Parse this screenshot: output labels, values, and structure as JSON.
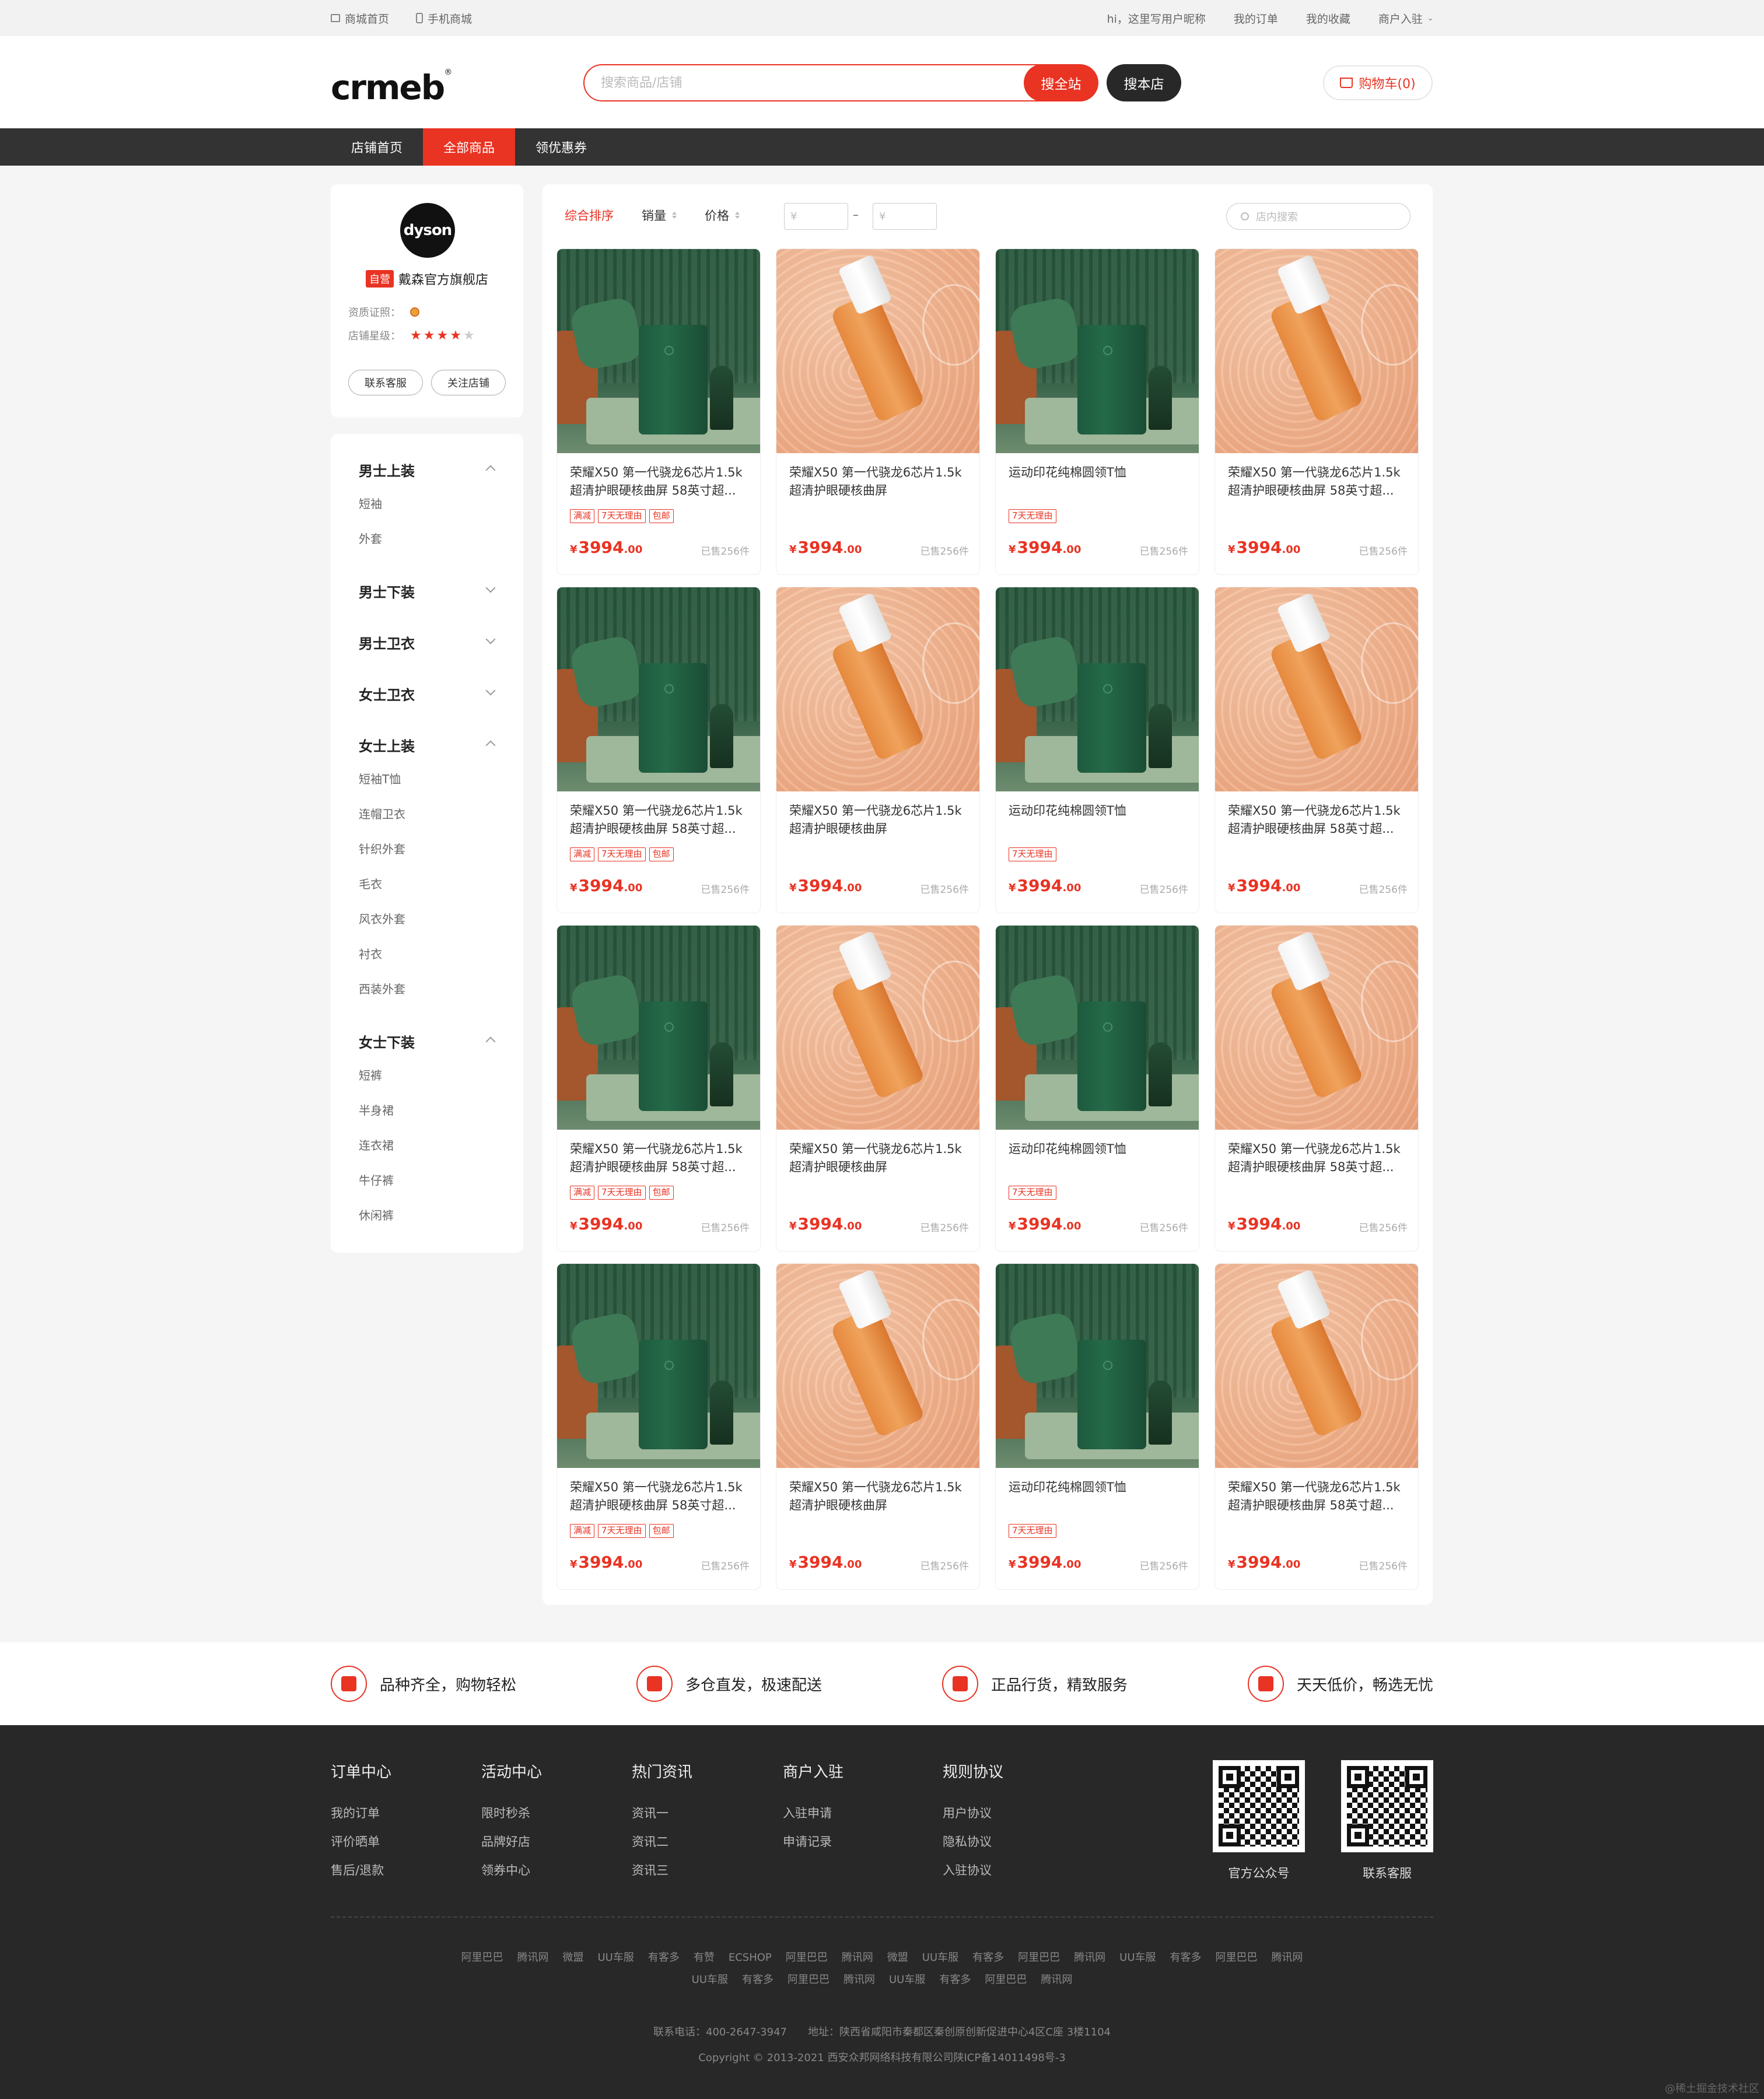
{
  "topbar": {
    "home": "商城首页",
    "mobile": "手机商城",
    "greeting": "hi，这里写用户昵称",
    "orders": "我的订单",
    "favorites": "我的收藏",
    "merchant": "商户入驻"
  },
  "header": {
    "logo": "crmeb",
    "search_placeholder": "搜索商品/店铺",
    "search_site": "搜全站",
    "search_store": "搜本店",
    "cart": "购物车(0)"
  },
  "nav": {
    "tabs": [
      "店铺首页",
      "全部商品",
      "领优惠券"
    ],
    "active": 1
  },
  "shop": {
    "logo_text": "dyson",
    "self_tag": "自营",
    "name": "戴森官方旗舰店",
    "license_label": "资质证照：",
    "rating_label": "店铺星级：",
    "rating": 4,
    "rating_max": 5,
    "contact_button": "联系客服",
    "follow_button": "关注店铺"
  },
  "categories": [
    {
      "name": "男士上装",
      "open": true,
      "subs": [
        "短袖",
        "外套"
      ]
    },
    {
      "name": "男士下装",
      "open": false,
      "subs": []
    },
    {
      "name": "男士卫衣",
      "open": false,
      "subs": []
    },
    {
      "name": "女士卫衣",
      "open": false,
      "subs": []
    },
    {
      "name": "女士上装",
      "open": true,
      "subs": [
        "短袖T恤",
        "连帽卫衣",
        "针织外套",
        "毛衣",
        "风衣外套",
        "衬衣",
        "西装外套"
      ]
    },
    {
      "name": "女士下装",
      "open": true,
      "subs": [
        "短裤",
        "半身裙",
        "连衣裙",
        "牛仔裤",
        "休闲裤"
      ]
    }
  ],
  "sortbar": {
    "default": "综合排序",
    "sales": "销量",
    "price": "价格",
    "min_placeholder": "¥",
    "max_placeholder": "¥",
    "dash": "–",
    "inshop_search": "店内搜索"
  },
  "product_templates": {
    "a": {
      "name": "荣耀X50 第一代骁龙6芯片1.5k超清护眼硬核曲屏 58英寸超...",
      "tags": [
        "满减",
        "7天无理由",
        "包邮"
      ],
      "image": "dehumidifier"
    },
    "b": {
      "name": "荣耀X50 第一代骁龙6芯片1.5k超清护眼硬核曲屏",
      "tags": [],
      "image": "serum"
    },
    "c": {
      "name": "运动印花纯棉圆领T恤",
      "tags": [
        "7天无理由"
      ],
      "image": "dehumidifier"
    },
    "d": {
      "name": "荣耀X50 第一代骁龙6芯片1.5k超清护眼硬核曲屏 58英寸超...",
      "tags": [],
      "image": "serum"
    }
  },
  "products": [
    {
      "name": "荣耀X50 第一代骁龙6芯片1.5k超清护眼硬核曲屏 58英寸超...",
      "tags": [
        "满减",
        "7天无理由",
        "包邮"
      ],
      "image": "dehumidifier",
      "currency": "¥",
      "price_int": "3994",
      "price_dec": ".00",
      "sold": "已售256件"
    },
    {
      "name": "荣耀X50 第一代骁龙6芯片1.5k超清护眼硬核曲屏",
      "tags": [],
      "image": "serum",
      "currency": "¥",
      "price_int": "3994",
      "price_dec": ".00",
      "sold": "已售256件"
    },
    {
      "name": "运动印花纯棉圆领T恤",
      "tags": [
        "7天无理由"
      ],
      "image": "dehumidifier",
      "currency": "¥",
      "price_int": "3994",
      "price_dec": ".00",
      "sold": "已售256件"
    },
    {
      "name": "荣耀X50 第一代骁龙6芯片1.5k超清护眼硬核曲屏 58英寸超...",
      "tags": [],
      "image": "serum",
      "currency": "¥",
      "price_int": "3994",
      "price_dec": ".00",
      "sold": "已售256件"
    },
    {
      "name": "荣耀X50 第一代骁龙6芯片1.5k超清护眼硬核曲屏 58英寸超...",
      "tags": [
        "满减",
        "7天无理由",
        "包邮"
      ],
      "image": "dehumidifier",
      "currency": "¥",
      "price_int": "3994",
      "price_dec": ".00",
      "sold": "已售256件"
    },
    {
      "name": "荣耀X50 第一代骁龙6芯片1.5k超清护眼硬核曲屏",
      "tags": [],
      "image": "serum",
      "currency": "¥",
      "price_int": "3994",
      "price_dec": ".00",
      "sold": "已售256件"
    },
    {
      "name": "运动印花纯棉圆领T恤",
      "tags": [
        "7天无理由"
      ],
      "image": "dehumidifier",
      "currency": "¥",
      "price_int": "3994",
      "price_dec": ".00",
      "sold": "已售256件"
    },
    {
      "name": "荣耀X50 第一代骁龙6芯片1.5k超清护眼硬核曲屏 58英寸超...",
      "tags": [],
      "image": "serum",
      "currency": "¥",
      "price_int": "3994",
      "price_dec": ".00",
      "sold": "已售256件"
    },
    {
      "name": "荣耀X50 第一代骁龙6芯片1.5k超清护眼硬核曲屏 58英寸超...",
      "tags": [
        "满减",
        "7天无理由",
        "包邮"
      ],
      "image": "dehumidifier",
      "currency": "¥",
      "price_int": "3994",
      "price_dec": ".00",
      "sold": "已售256件"
    },
    {
      "name": "荣耀X50 第一代骁龙6芯片1.5k超清护眼硬核曲屏",
      "tags": [],
      "image": "serum",
      "currency": "¥",
      "price_int": "3994",
      "price_dec": ".00",
      "sold": "已售256件"
    },
    {
      "name": "运动印花纯棉圆领T恤",
      "tags": [
        "7天无理由"
      ],
      "image": "dehumidifier",
      "currency": "¥",
      "price_int": "3994",
      "price_dec": ".00",
      "sold": "已售256件"
    },
    {
      "name": "荣耀X50 第一代骁龙6芯片1.5k超清护眼硬核曲屏 58英寸超...",
      "tags": [],
      "image": "serum",
      "currency": "¥",
      "price_int": "3994",
      "price_dec": ".00",
      "sold": "已售256件"
    },
    {
      "name": "荣耀X50 第一代骁龙6芯片1.5k超清护眼硬核曲屏 58英寸超...",
      "tags": [
        "满减",
        "7天无理由",
        "包邮"
      ],
      "image": "dehumidifier",
      "currency": "¥",
      "price_int": "3994",
      "price_dec": ".00",
      "sold": "已售256件"
    },
    {
      "name": "荣耀X50 第一代骁龙6芯片1.5k超清护眼硬核曲屏",
      "tags": [],
      "image": "serum",
      "currency": "¥",
      "price_int": "3994",
      "price_dec": ".00",
      "sold": "已售256件"
    },
    {
      "name": "运动印花纯棉圆领T恤",
      "tags": [
        "7天无理由"
      ],
      "image": "dehumidifier",
      "currency": "¥",
      "price_int": "3994",
      "price_dec": ".00",
      "sold": "已售256件"
    },
    {
      "name": "荣耀X50 第一代骁龙6芯片1.5k超清护眼硬核曲屏 58英寸超...",
      "tags": [],
      "image": "serum",
      "currency": "¥",
      "price_int": "3994",
      "price_dec": ".00",
      "sold": "已售256件"
    }
  ],
  "features": [
    {
      "icon": "bag-icon",
      "text": "品种齐全，购物轻松"
    },
    {
      "icon": "truck-icon",
      "text": "多仓直发，极速配送"
    },
    {
      "icon": "shield-icon",
      "text": "正品行货，精致服务"
    },
    {
      "icon": "coupon-icon",
      "text": "天天低价，畅选无忧"
    }
  ],
  "footer": {
    "columns": [
      {
        "title": "订单中心",
        "links": [
          "我的订单",
          "评价晒单",
          "售后/退款"
        ]
      },
      {
        "title": "活动中心",
        "links": [
          "限时秒杀",
          "品牌好店",
          "领券中心"
        ]
      },
      {
        "title": "热门资讯",
        "links": [
          "资讯一",
          "资讯二",
          "资讯三"
        ]
      },
      {
        "title": "商户入驻",
        "links": [
          "入驻申请",
          "申请记录"
        ]
      },
      {
        "title": "规则协议",
        "links": [
          "用户协议",
          "隐私协议",
          "入驻协议"
        ]
      }
    ],
    "qr": [
      {
        "caption": "官方公众号"
      },
      {
        "caption": "联系客服"
      }
    ],
    "links_row1": [
      "阿里巴巴",
      "腾讯网",
      "微盟",
      "UU车服",
      "有客多",
      "有赞",
      "ECSHOP",
      "阿里巴巴",
      "腾讯网",
      "微盟",
      "UU车服",
      "有客多",
      "阿里巴巴",
      "腾讯网",
      "UU车服",
      "有客多",
      "阿里巴巴",
      "腾讯网"
    ],
    "links_row2": [
      "UU车服",
      "有客多",
      "阿里巴巴",
      "腾讯网",
      "UU车服",
      "有客多",
      "阿里巴巴",
      "腾讯网"
    ],
    "contact": "联系电话：400-2647-3947　　地址：陕西省咸阳市秦都区秦创原创新促进中心4区C座 3楼1104",
    "copyright": "Copyright © 2013-2021 西安众邦网络科技有限公司陕ICP备14011498号-3",
    "watermark": "@稀土掘金技术社区"
  },
  "colors": {
    "accent": "#e93323",
    "dark": "#333333",
    "footer_bg": "#282828"
  }
}
